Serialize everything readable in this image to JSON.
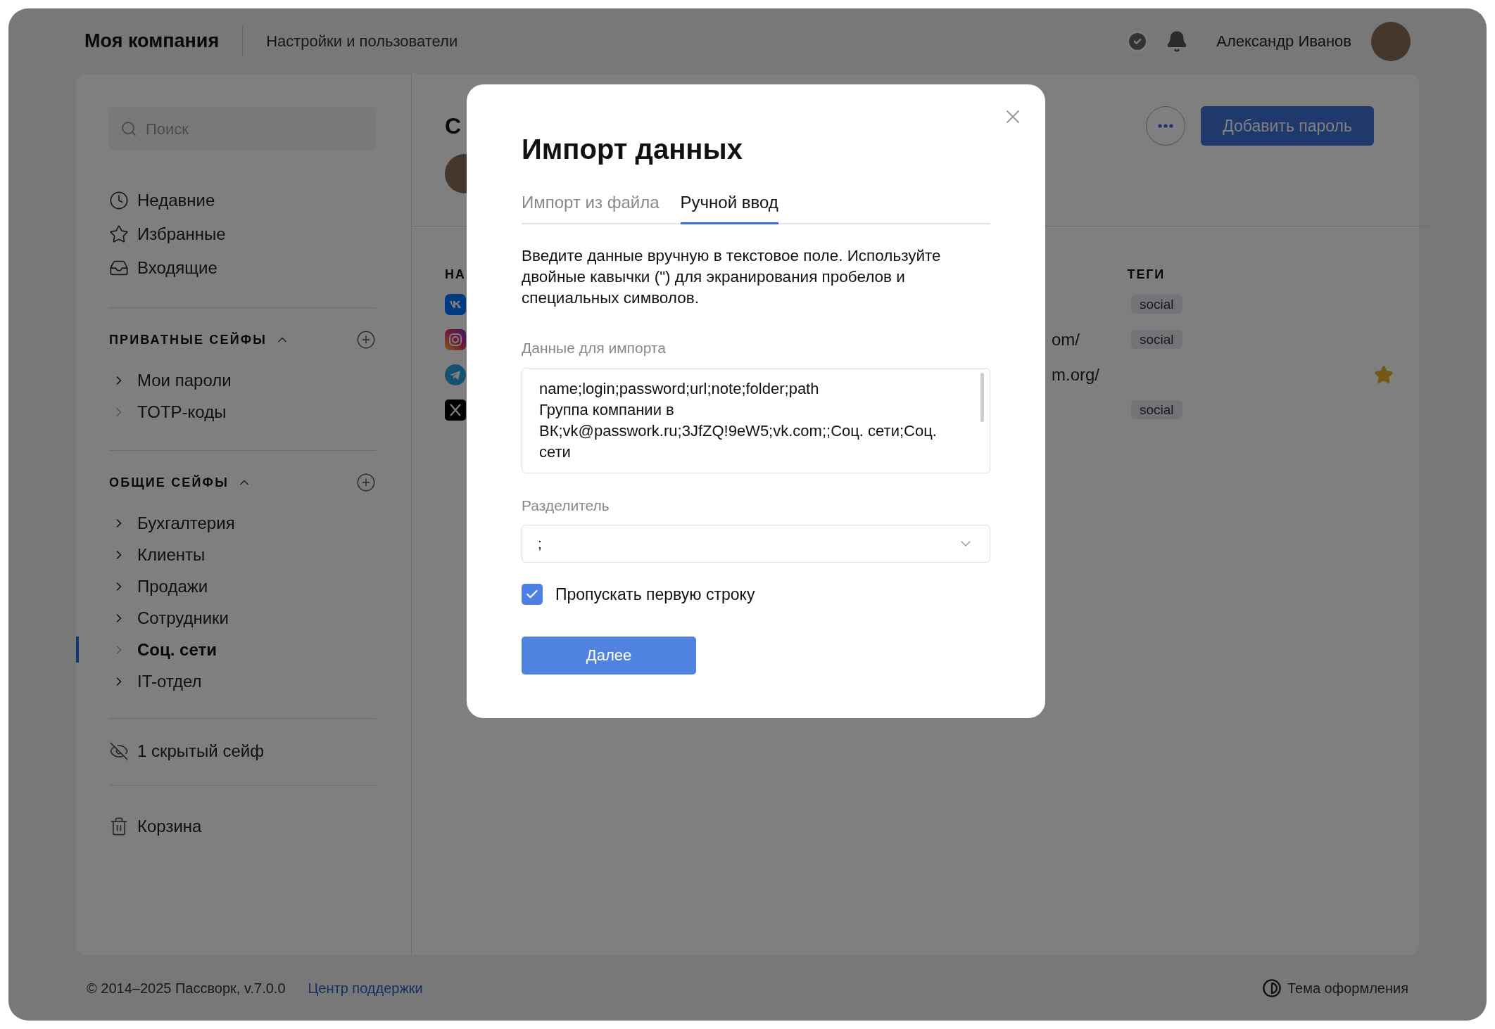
{
  "header": {
    "company": "Моя компания",
    "section": "Настройки и пользователи",
    "user": "Александр Иванов"
  },
  "sidebar": {
    "search_placeholder": "Поиск",
    "nav": [
      {
        "kind": "clock",
        "label": "Недавние"
      },
      {
        "kind": "star",
        "label": "Избранные"
      },
      {
        "kind": "inbox",
        "label": "Входящие"
      }
    ],
    "sections": [
      {
        "title": "ПРИВАТНЫЕ СЕЙФЫ",
        "expanded": true,
        "items": [
          {
            "label": "Мои пароли",
            "expandable": true,
            "selected": false
          },
          {
            "label": "TOTP-коды",
            "expandable": false,
            "selected": false
          }
        ]
      },
      {
        "title": "ОБЩИЕ СЕЙФЫ",
        "expanded": true,
        "items": [
          {
            "label": "Бухгалтерия",
            "expandable": true,
            "selected": false
          },
          {
            "label": "Клиенты",
            "expandable": true,
            "selected": false
          },
          {
            "label": "Продажи",
            "expandable": true,
            "selected": false
          },
          {
            "label": "Сотрудники",
            "expandable": true,
            "selected": false
          },
          {
            "label": "Соц. сети",
            "expandable": false,
            "selected": true
          },
          {
            "label": "IT-отдел",
            "expandable": true,
            "selected": false
          }
        ]
      }
    ],
    "hidden_vaults": "1 скрытый сейф",
    "trash": "Корзина"
  },
  "main": {
    "title": "С",
    "add_button": "Добавить пароль",
    "columns": {
      "name": "НА",
      "tags": "ТЕГИ"
    },
    "rows": [
      {
        "kind": "vk",
        "url": "",
        "tag": "social",
        "favorite": false
      },
      {
        "kind": "instagram",
        "url": "om/",
        "tag": "social",
        "favorite": false
      },
      {
        "kind": "telegram",
        "url": "m.org/",
        "favorite": true
      },
      {
        "kind": "x",
        "url": "",
        "tag": "social",
        "favorite": false
      }
    ]
  },
  "modal": {
    "title": "Импорт данных",
    "tabs": [
      {
        "label": "Импорт из файла",
        "selected": false
      },
      {
        "label": "Ручной ввод",
        "selected": true
      }
    ],
    "description": "Введите данные вручную в текстовое поле. Используйте двойные кавычки (\") для экранирования пробелов и специальных символов.",
    "data_label": "Данные для импорта",
    "data_value": "name;login;password;url;note;folder;path\nГруппа компании в ВК;vk@passwork.ru;3JfZQ!9eW5;vk.com;;Соц. сети;Соц. сети",
    "separator_label": "Разделитель",
    "separator_value": ";",
    "skip_first_row": {
      "label": "Пропускать первую строку",
      "checked": true
    },
    "next_button": "Далее"
  },
  "footer": {
    "copyright": "© 2014–2025 Пассворк, v.7.0.0",
    "support_link": "Центр поддержки",
    "theme": "Тема оформления"
  }
}
